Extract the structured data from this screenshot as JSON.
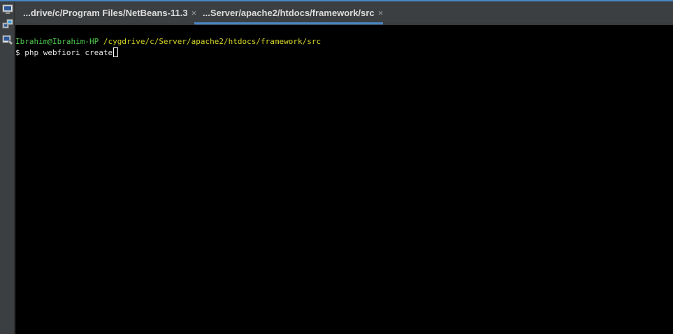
{
  "tabs": [
    {
      "label": "...drive/c/Program Files/NetBeans-11.3",
      "close": "×",
      "active": false
    },
    {
      "label": "...Server/apache2/htdocs/framework/src",
      "close": "×",
      "active": true
    }
  ],
  "side_toolbar": {
    "icons": [
      "terminal-window-icon",
      "remote-connection-icon",
      "terminal-settings-icon"
    ]
  },
  "terminal": {
    "prompt_user": "Ibrahim@Ibrahim-HP",
    "prompt_path": "/cygdrive/c/Server/apache2/htdocs/framework/src",
    "prompt_symbol": "$",
    "command": "php webfiori create"
  },
  "colors": {
    "accent": "#4a88c7",
    "user": "#4ec94e",
    "path": "#d4d429",
    "terminal_bg": "#000000"
  }
}
